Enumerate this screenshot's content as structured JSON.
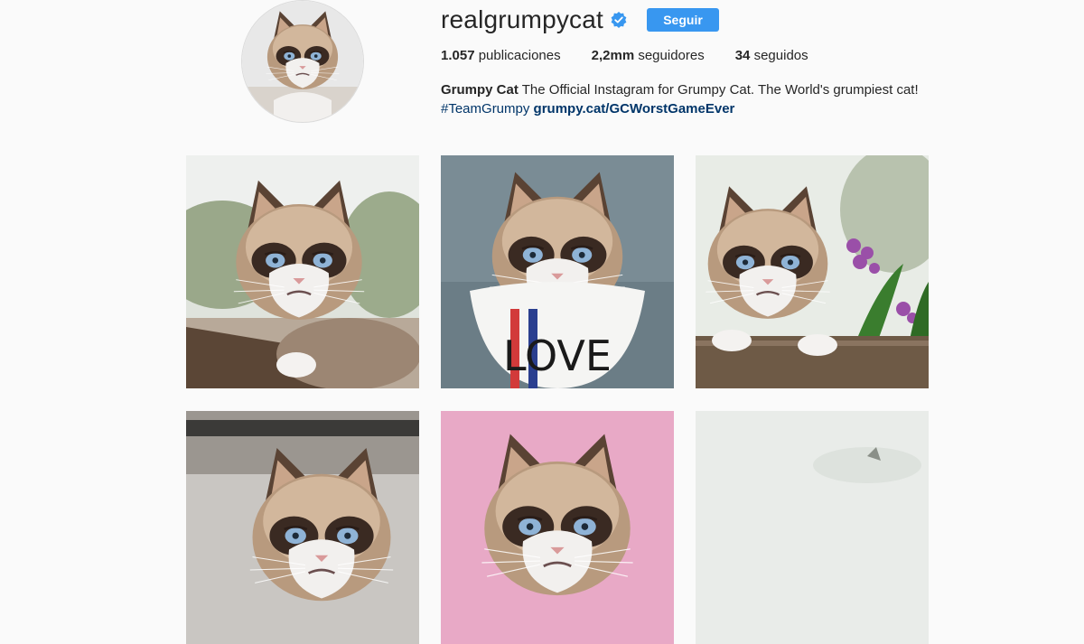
{
  "profile": {
    "username": "realgrumpycat",
    "verified_icon": "verified-badge-icon",
    "follow_label": "Seguir",
    "avatar_icon": "grumpy-cat-avatar"
  },
  "stats": {
    "posts_value": "1.057",
    "posts_label": "publicaciones",
    "followers_value": "2,2mm",
    "followers_label": "seguidores",
    "following_value": "34",
    "following_label": "seguidos"
  },
  "bio": {
    "name": "Grumpy Cat",
    "text": "The Official Instagram for Grumpy Cat. The World's grumpiest cat!",
    "hashtag": "#TeamGrumpy",
    "link": "grumpy.cat/GCWorstGameEver"
  },
  "posts": [
    {
      "subject": "grumpy cat on log",
      "bib_text": ""
    },
    {
      "subject": "grumpy cat wearing bib",
      "bib_text": "LOVE"
    },
    {
      "subject": "grumpy cat with flowers",
      "bib_text": ""
    },
    {
      "subject": "grumpy cat indoors",
      "bib_text": ""
    },
    {
      "subject": "grumpy cat pink background",
      "bib_text": ""
    },
    {
      "subject": "grumpy cat light background",
      "bib_text": ""
    }
  ],
  "colors": {
    "accent": "#3897f0",
    "link": "#003569",
    "background": "#fafafa"
  }
}
